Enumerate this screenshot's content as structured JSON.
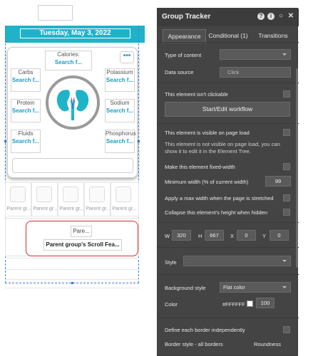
{
  "canvas": {
    "date_label": "Tuesday, May 3, 2022",
    "more_button": "•••",
    "stats": {
      "calories": {
        "label": "Calories:",
        "value": "Search f..."
      },
      "carbs": {
        "label": "Carbs",
        "value": "Search f..."
      },
      "potassium": {
        "label": "Potassium",
        "value": "Search f..."
      },
      "protein": {
        "label": "Protein",
        "value": "Search f..."
      },
      "sodium": {
        "label": "Sodium",
        "value": "Search f..."
      },
      "fluids": {
        "label": "Fluids",
        "value": "Search f..."
      },
      "phosphorus": {
        "label": "Phosphorus",
        "value": "Search f..."
      }
    },
    "repeating_group_labels": [
      "Parent gr...",
      "Parent gr...",
      "Parent gr...",
      "Parent gr...",
      "Parent gr..."
    ],
    "scroll_card": {
      "pare": "Pare...",
      "scroll_label": "Parent group's Scroll Fea..."
    }
  },
  "panel": {
    "title": "Group Tracker",
    "icons": [
      "help-icon",
      "info-icon",
      "comment-icon",
      "close-icon"
    ],
    "tabs": [
      "Appearance",
      "Conditional (1)",
      "Transitions"
    ],
    "type_of_content": {
      "label": "Type of content",
      "value": ""
    },
    "data_source": {
      "label": "Data source",
      "placeholder": "Click"
    },
    "not_clickable": {
      "label": "This element isn't clickable"
    },
    "workflow_button": "Start/Edit workflow",
    "visible_on_load": {
      "label": "This element is visible on page load"
    },
    "visibility_note": "This element is not visible on page load, you can show it to edit it in the Element Tree.",
    "fixed_width": {
      "label": "Make this element fixed-width"
    },
    "min_width": {
      "label": "Minimum width (% of current width)",
      "value": "99"
    },
    "max_width": {
      "label": "Apply a max width when the page is stretched"
    },
    "collapse_height": {
      "label": "Collapse this element's height when hidden"
    },
    "dimensions": {
      "w_label": "W",
      "w": "320",
      "h_label": "H",
      "h": "667",
      "x_label": "X",
      "x": "0",
      "y_label": "Y",
      "y": "0"
    },
    "style": {
      "label": "Style",
      "value": ""
    },
    "background_style": {
      "label": "Background style",
      "value": "Flat color"
    },
    "color": {
      "label": "Color",
      "hex": "#FFFFFF",
      "opacity": "100"
    },
    "border_independent": {
      "label": "Define each border independently"
    },
    "border_style": {
      "label": "Border style - all borders",
      "roundness_label": "Roundness"
    }
  },
  "colors": {
    "accent": "#1fb3c8",
    "link": "#1a9cc7",
    "panel_bg": "#444444",
    "selection": "#3b7dd8",
    "scroll_card_border": "#d62d2d"
  }
}
